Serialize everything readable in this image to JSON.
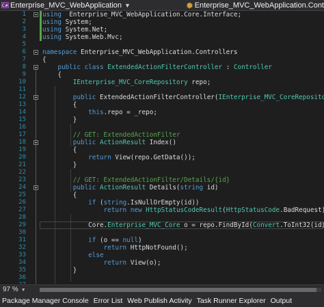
{
  "navbar": {
    "project_label": "Enterprise_MVC_WebApplication",
    "class_label": "Enterprise_MVC_WebApplication.Cont"
  },
  "editor": {
    "zoom": "97 %",
    "lines": [
      {
        "n": "1",
        "t": [
          [
            "kw",
            "using"
          ],
          [
            "",
            "  Enterprise_MVC_WebApplication.Core.Interface;"
          ]
        ]
      },
      {
        "n": "2",
        "t": [
          [
            "kw",
            "using"
          ],
          [
            "",
            " System;"
          ]
        ]
      },
      {
        "n": "3",
        "t": [
          [
            "kw",
            "using"
          ],
          [
            "",
            " System.Net;"
          ]
        ]
      },
      {
        "n": "4",
        "t": [
          [
            "kw",
            "using"
          ],
          [
            "",
            " System.Web.Mvc;"
          ]
        ]
      },
      {
        "n": "5",
        "t": []
      },
      {
        "n": "6",
        "t": [
          [
            "kw",
            "namespace"
          ],
          [
            "",
            " Enterprise_MVC_WebApplication.Controllers"
          ]
        ]
      },
      {
        "n": "7",
        "t": [
          [
            "",
            "{"
          ]
        ]
      },
      {
        "n": "8",
        "t": [
          [
            "",
            "    "
          ],
          [
            "kw",
            "public"
          ],
          [
            "",
            " "
          ],
          [
            "kw",
            "class"
          ],
          [
            "",
            " "
          ],
          [
            "ty",
            "ExtendedActionFilterController"
          ],
          [
            "",
            " : "
          ],
          [
            "ty",
            "Controller"
          ]
        ]
      },
      {
        "n": "9",
        "t": [
          [
            "",
            "    {"
          ]
        ]
      },
      {
        "n": "10",
        "t": [
          [
            "",
            "        "
          ],
          [
            "ty",
            "IEnterprise_MVC_CoreRepository"
          ],
          [
            "",
            " repo;"
          ]
        ]
      },
      {
        "n": "11",
        "t": []
      },
      {
        "n": "12",
        "t": [
          [
            "",
            "        "
          ],
          [
            "kw",
            "public"
          ],
          [
            "",
            " ExtendedActionFilterController("
          ],
          [
            "ty",
            "IEnterprise_MVC_CoreRepository"
          ],
          [
            "",
            " _repo)"
          ]
        ]
      },
      {
        "n": "13",
        "t": [
          [
            "",
            "        {"
          ]
        ]
      },
      {
        "n": "14",
        "t": [
          [
            "",
            "            "
          ],
          [
            "kw",
            "this"
          ],
          [
            "",
            ".repo = _repo;"
          ]
        ]
      },
      {
        "n": "15",
        "t": [
          [
            "",
            "        }"
          ]
        ]
      },
      {
        "n": "16",
        "t": []
      },
      {
        "n": "17",
        "t": [
          [
            "",
            "        "
          ],
          [
            "cm",
            "// GET: ExtendedActionFilter"
          ]
        ]
      },
      {
        "n": "18",
        "t": [
          [
            "",
            "        "
          ],
          [
            "kw",
            "public"
          ],
          [
            "",
            " "
          ],
          [
            "ty",
            "ActionResult"
          ],
          [
            "",
            " Index()"
          ]
        ]
      },
      {
        "n": "19",
        "t": [
          [
            "",
            "        {"
          ]
        ]
      },
      {
        "n": "20",
        "t": [
          [
            "",
            "            "
          ],
          [
            "kw",
            "return"
          ],
          [
            "",
            " View(repo.GetData());"
          ]
        ]
      },
      {
        "n": "21",
        "t": [
          [
            "",
            "        }"
          ]
        ]
      },
      {
        "n": "22",
        "t": []
      },
      {
        "n": "23",
        "t": [
          [
            "",
            "        "
          ],
          [
            "cm",
            "// GET: ExtendedActionFilter/Details/{id}"
          ]
        ]
      },
      {
        "n": "24",
        "t": [
          [
            "",
            "        "
          ],
          [
            "kw",
            "public"
          ],
          [
            "",
            " "
          ],
          [
            "ty",
            "ActionResult"
          ],
          [
            "",
            " Details("
          ],
          [
            "kw",
            "string"
          ],
          [
            "",
            " id)"
          ]
        ]
      },
      {
        "n": "25",
        "t": [
          [
            "",
            "        {"
          ]
        ]
      },
      {
        "n": "26",
        "t": [
          [
            "",
            "            "
          ],
          [
            "kw",
            "if"
          ],
          [
            "",
            " ("
          ],
          [
            "kw",
            "string"
          ],
          [
            "",
            ".IsNullOrEmpty(id))"
          ]
        ]
      },
      {
        "n": "27",
        "t": [
          [
            "",
            "                "
          ],
          [
            "kw",
            "return"
          ],
          [
            "",
            " "
          ],
          [
            "kw",
            "new"
          ],
          [
            "",
            " "
          ],
          [
            "ty",
            "HttpStatusCodeResult"
          ],
          [
            "",
            "("
          ],
          [
            "ty",
            "HttpStatusCode"
          ],
          [
            "",
            ".BadRequest);"
          ]
        ]
      },
      {
        "n": "28",
        "t": []
      },
      {
        "n": "29",
        "t": [
          [
            "",
            "            Core."
          ],
          [
            "ty",
            "Enterprise_MVC_Core"
          ],
          [
            "",
            " o = repo.FindById("
          ],
          [
            "ty",
            "Convert"
          ],
          [
            "",
            ".ToInt32(id));"
          ]
        ]
      },
      {
        "n": "30",
        "t": []
      },
      {
        "n": "31",
        "t": [
          [
            "",
            "            "
          ],
          [
            "kw",
            "if"
          ],
          [
            "",
            " (o == "
          ],
          [
            "kw",
            "null"
          ],
          [
            "",
            ")"
          ]
        ]
      },
      {
        "n": "32",
        "t": [
          [
            "",
            "                "
          ],
          [
            "kw",
            "return"
          ],
          [
            "",
            " HttpNotFound();"
          ]
        ]
      },
      {
        "n": "33",
        "t": [
          [
            "",
            "            "
          ],
          [
            "kw",
            "else"
          ]
        ]
      },
      {
        "n": "34",
        "t": [
          [
            "",
            "                "
          ],
          [
            "kw",
            "return"
          ],
          [
            "",
            " View(o);"
          ]
        ]
      },
      {
        "n": "35",
        "t": [
          [
            "",
            "        }"
          ]
        ]
      },
      {
        "n": "36",
        "t": []
      },
      {
        "n": "37",
        "t": []
      }
    ]
  },
  "bottom_tabs": [
    "Package Manager Console",
    "Error List",
    "Web Publish Activity",
    "Task Runner Explorer",
    "Output"
  ],
  "icons": {
    "project": "csharp-project-icon",
    "class": "class-icon",
    "dropdown": "chevron-down-icon"
  },
  "colors": {
    "keyword": "#569cd6",
    "type": "#4ec9b0",
    "comment": "#57a64a",
    "line_number": "#2b91af",
    "text": "#dcdcdc",
    "background": "#1e1e1e"
  }
}
